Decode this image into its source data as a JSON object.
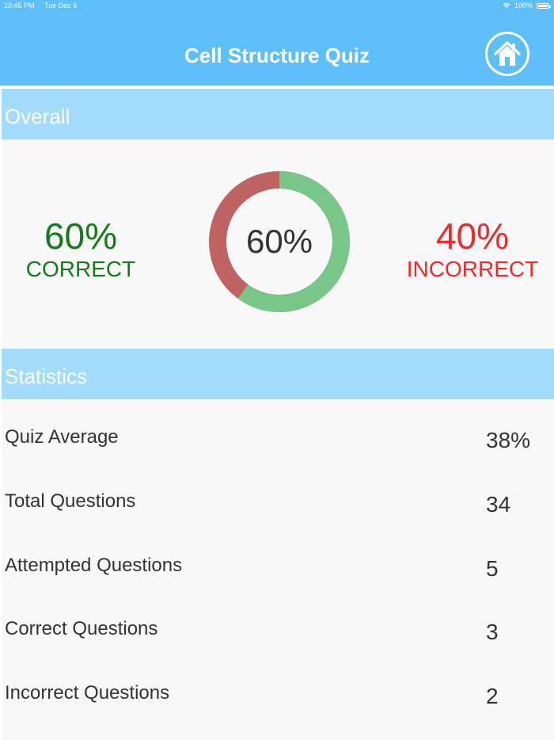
{
  "status_bar": {
    "time": "10:45 PM",
    "date": "Tue Dec 6",
    "battery": "100%"
  },
  "header": {
    "title": "Cell Structure Quiz",
    "home_icon": "home-icon"
  },
  "colors": {
    "header_bg": "#5dbef8",
    "section_bg": "#a3dcfb",
    "correct_text": "#137b17",
    "incorrect_text": "#ed2b2b",
    "donut_correct": "#78c789",
    "donut_incorrect": "#bf6363"
  },
  "overall": {
    "section_label": "Overall",
    "correct_pct": "60%",
    "correct_label": "CORRECT",
    "incorrect_pct": "40%",
    "incorrect_label": "INCORRECT",
    "donut_center": "60%",
    "correct_fraction": 0.6
  },
  "statistics": {
    "section_label": "Statistics",
    "rows": [
      {
        "label": "Quiz Average",
        "value": "38%"
      },
      {
        "label": "Total Questions",
        "value": "34"
      },
      {
        "label": "Attempted Questions",
        "value": "5"
      },
      {
        "label": "Correct Questions",
        "value": "3"
      },
      {
        "label": "Incorrect Questions",
        "value": "2"
      }
    ]
  }
}
